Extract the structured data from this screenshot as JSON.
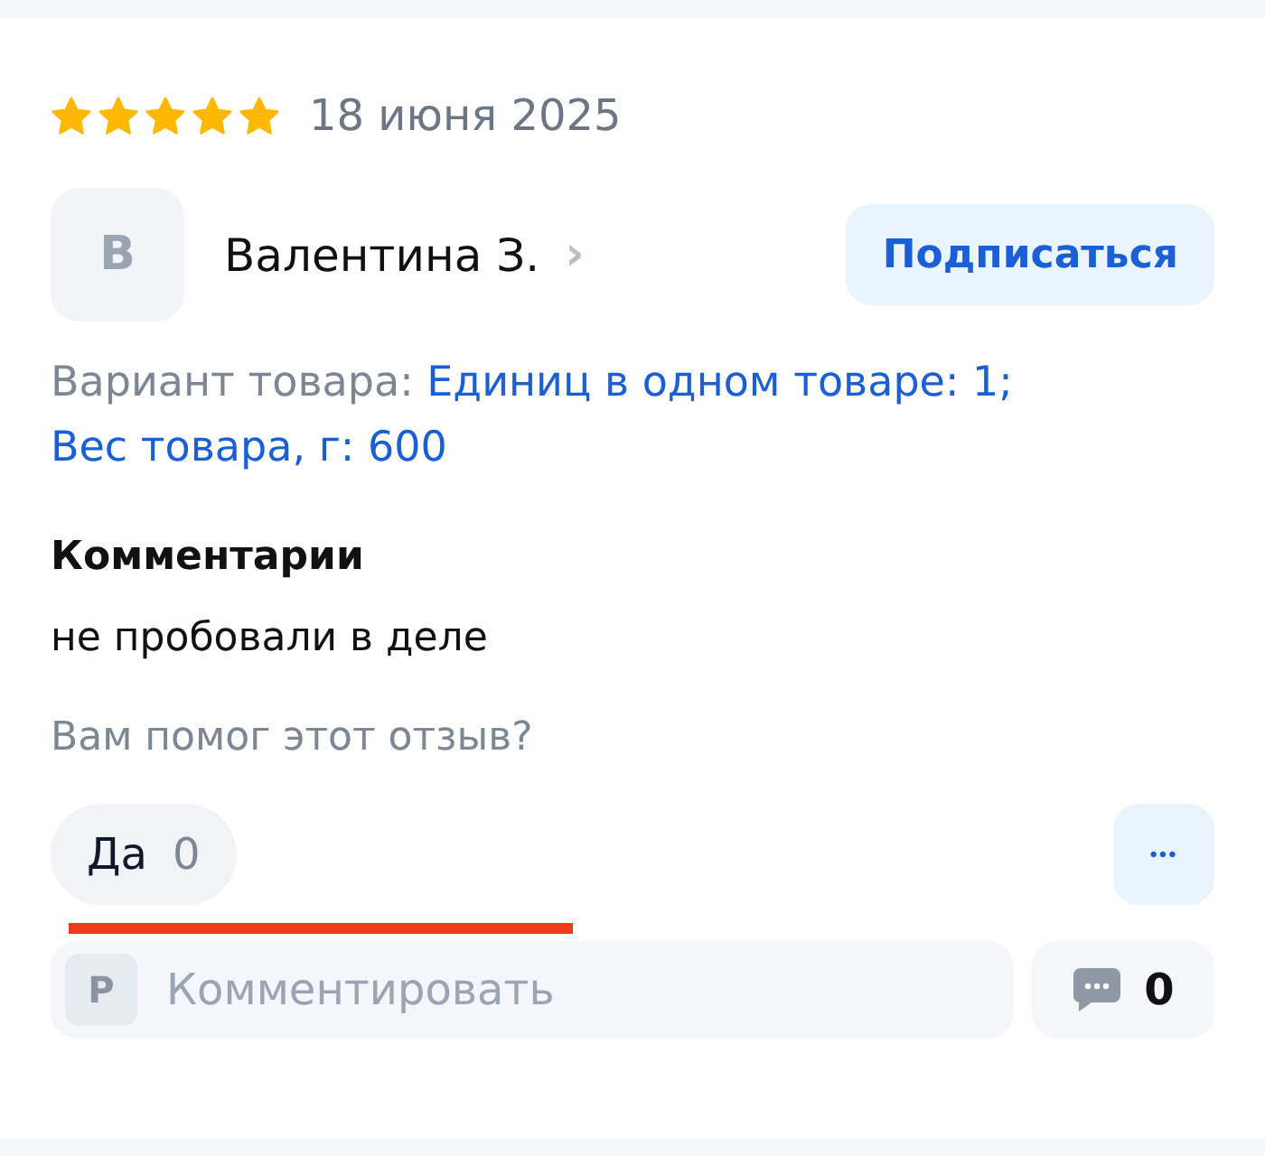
{
  "review": {
    "stars": 5,
    "date": "18 июня 2025"
  },
  "author": {
    "initial": "В",
    "name": "Валентина З.",
    "chevron": "›",
    "subscribe": "Подписаться"
  },
  "variant": {
    "label": "Вариант товара:",
    "value": "Единиц в одном товаре: 1; Вес товара, г: 600"
  },
  "comment": {
    "title": "Комментарии",
    "text": "не пробовали в деле"
  },
  "helpful": {
    "question": "Вам помог этот отзыв?",
    "yes_label": "Да",
    "yes_count": "0",
    "more": "•••"
  },
  "reply": {
    "initial": "Р",
    "placeholder": "Комментировать",
    "count": "0"
  }
}
